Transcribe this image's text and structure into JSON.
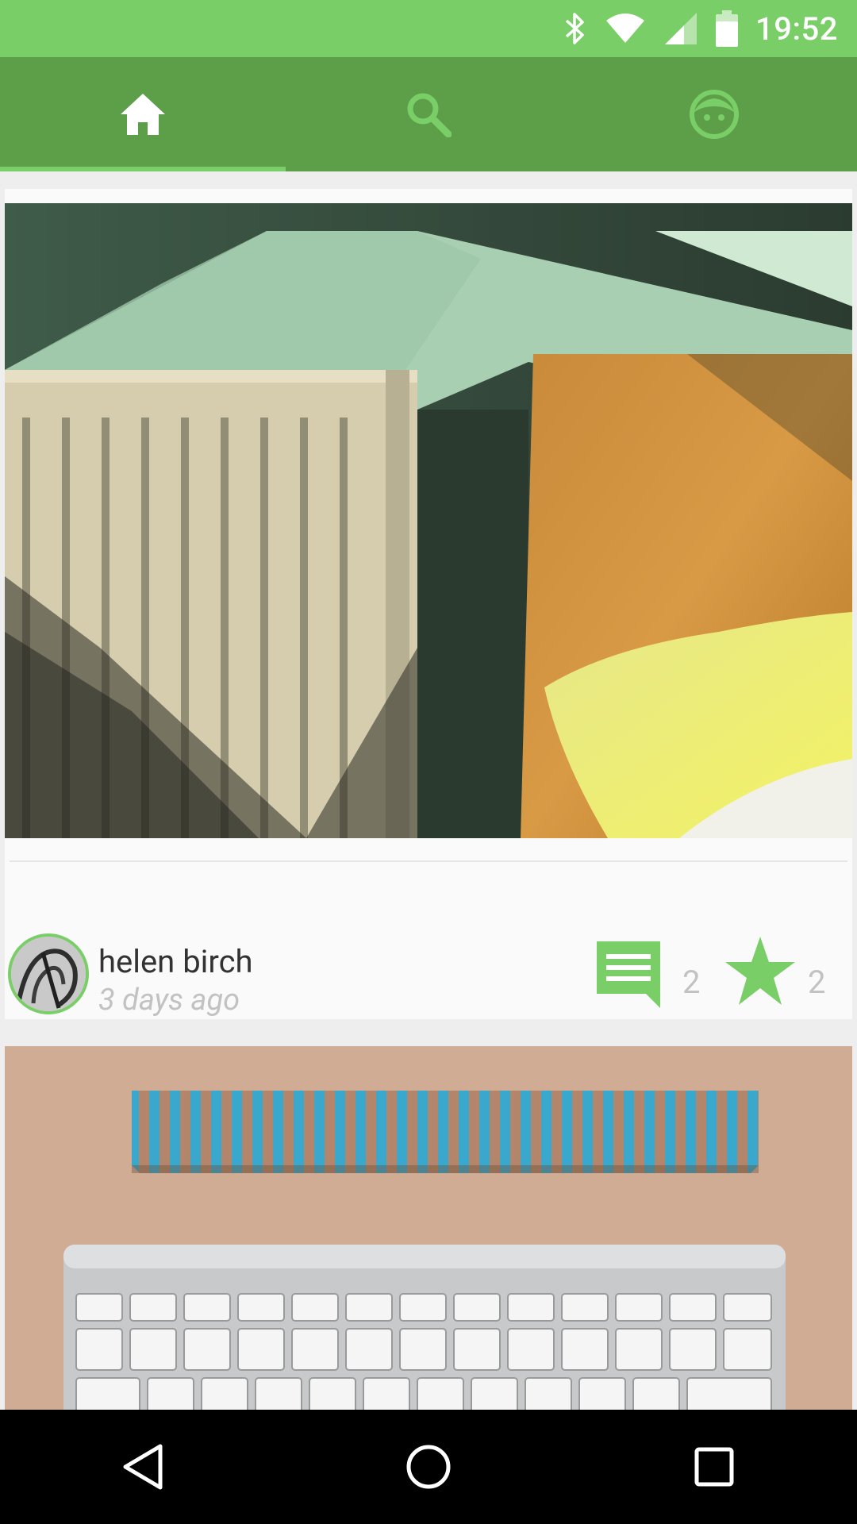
{
  "status_bar": {
    "time": "19:52",
    "icons": [
      "bluetooth-icon",
      "wifi-icon",
      "signal-icon",
      "battery-icon"
    ]
  },
  "tabs": [
    {
      "name": "home",
      "icon": "home-icon",
      "active": true
    },
    {
      "name": "search",
      "icon": "search-icon",
      "active": false
    },
    {
      "name": "profile",
      "icon": "face-icon",
      "active": false
    }
  ],
  "posts": [
    {
      "image": "radiator-and-bed-photo",
      "author": "helen birch",
      "time_ago": "3 days ago",
      "comments": "2",
      "stars": "2"
    },
    {
      "image": "keyboard-and-striped-block-photo"
    }
  ],
  "colors": {
    "status_bar": "#7ace68",
    "app_bar": "#5d9e49",
    "accent": "#7ace68",
    "muted_text": "#c2c2c2"
  },
  "nav": [
    "back-icon",
    "home-circle-icon",
    "recents-icon"
  ]
}
